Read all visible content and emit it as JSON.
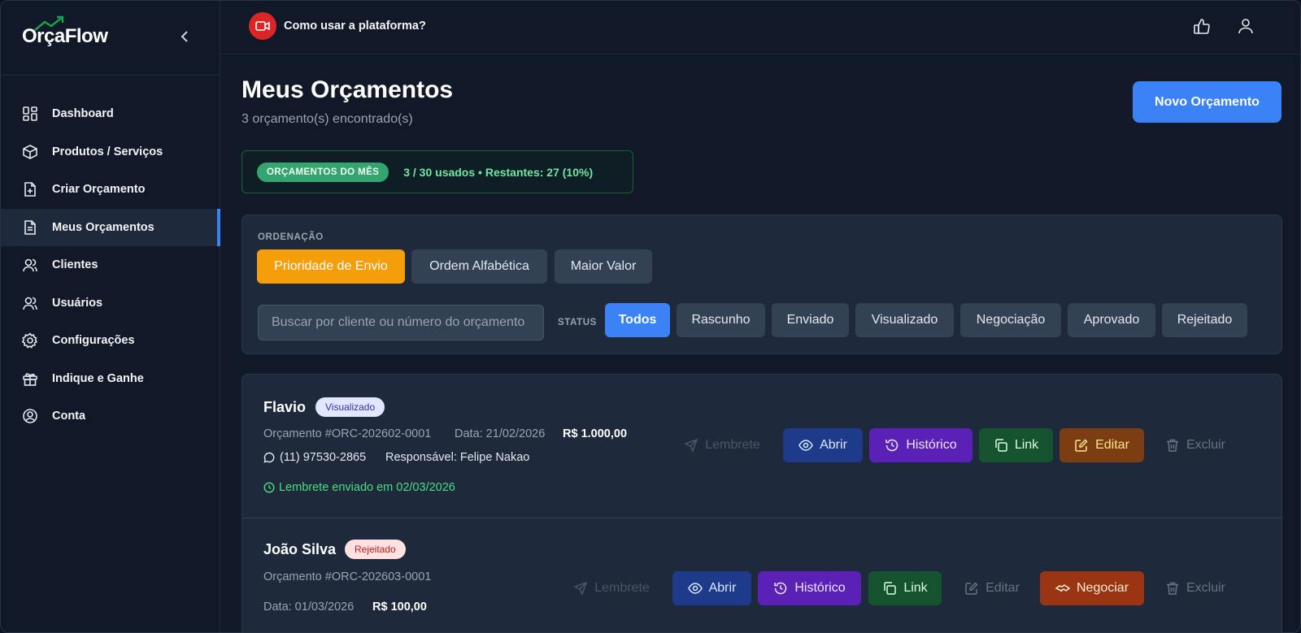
{
  "brand": {
    "name": "OrçaFlow"
  },
  "sidebar": {
    "items": [
      {
        "label": "Dashboard",
        "icon": "dashboard-icon"
      },
      {
        "label": "Produtos / Serviços",
        "icon": "box-icon"
      },
      {
        "label": "Criar Orçamento",
        "icon": "file-plus-icon"
      },
      {
        "label": "Meus Orçamentos",
        "icon": "file-text-icon",
        "active": true
      },
      {
        "label": "Clientes",
        "icon": "users-icon"
      },
      {
        "label": "Usuários",
        "icon": "users-icon"
      },
      {
        "label": "Configurações",
        "icon": "gear-icon"
      },
      {
        "label": "Indique e Ganhe",
        "icon": "gift-icon"
      },
      {
        "label": "Conta",
        "icon": "user-circle-icon"
      }
    ]
  },
  "topbar": {
    "help_text": "Como usar a plataforma?"
  },
  "page": {
    "title": "Meus Orçamentos",
    "subtitle": "3 orçamento(s) encontrado(s)",
    "new_button": "Novo Orçamento"
  },
  "quota": {
    "badge": "ORÇAMENTOS DO MÊS",
    "text": "3 / 30 usados • Restantes: 27 (10%)"
  },
  "filters": {
    "sort_label": "ORDENAÇÃO",
    "sort_options": [
      "Prioridade de Envio",
      "Ordem Alfabética",
      "Maior Valor"
    ],
    "sort_selected": "Prioridade de Envio",
    "search_placeholder": "Buscar por cliente ou número do orçamento",
    "status_label": "STATUS",
    "status_options": [
      "Todos",
      "Rascunho",
      "Enviado",
      "Visualizado",
      "Negociação",
      "Aprovado",
      "Rejeitado"
    ],
    "status_selected": "Todos"
  },
  "quotes": [
    {
      "client": "Flavio",
      "status": "Visualizado",
      "number": "Orçamento #ORC-202602-0001",
      "date": "Data: 21/02/2026",
      "value": "R$ 1.000,00",
      "phone": "(11) 97530-2865",
      "responsible": "Responsável: Felipe Nakao",
      "reminder_info": "Lembrete enviado em 02/03/2026",
      "actions": [
        "Lembrete",
        "Abrir",
        "Histórico",
        "Link",
        "Editar",
        "Excluir"
      ]
    },
    {
      "client": "João Silva",
      "status": "Rejeitado",
      "number": "Orçamento #ORC-202603-0001",
      "date": "Data: 01/03/2026",
      "value": "R$ 100,00",
      "actions": [
        "Lembrete",
        "Abrir",
        "Histórico",
        "Link",
        "Editar",
        "Negociar",
        "Excluir"
      ]
    }
  ],
  "colors": {
    "accent": "#3b82f6",
    "sort_active": "#f59e0b",
    "background": "#111827"
  }
}
